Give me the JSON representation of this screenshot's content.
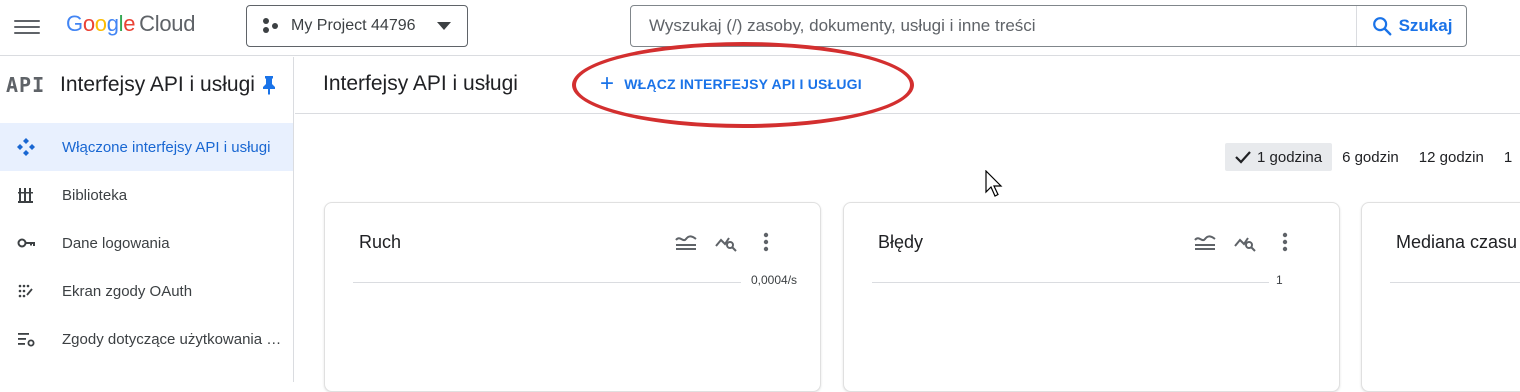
{
  "header": {
    "logo_google": [
      "G",
      "o",
      "o",
      "g",
      "l",
      "e"
    ],
    "logo_cloud": "Cloud",
    "project_name": "My Project 44796",
    "search_placeholder": "Wyszukaj (/) zasoby, dokumenty, usługi i inne treści",
    "search_button": "Szukaj"
  },
  "sidebar": {
    "icon_text": "API",
    "title": "Interfejsy API i usługi",
    "items": [
      {
        "label": "Włączone interfejsy API i usługi",
        "icon": "api-diamond-icon",
        "active": true
      },
      {
        "label": "Biblioteka",
        "icon": "library-icon",
        "active": false
      },
      {
        "label": "Dane logowania",
        "icon": "key-icon",
        "active": false
      },
      {
        "label": "Ekran zgody OAuth",
        "icon": "oauth-consent-icon",
        "active": false
      },
      {
        "label": "Zgody dotyczące użytkowania danych",
        "icon": "data-usage-icon",
        "active": false
      }
    ]
  },
  "main": {
    "title": "Interfejsy API i usługi",
    "enable_button": "WŁĄCZ INTERFEJSY API I USŁUGI",
    "time_range": {
      "options": [
        "1 godzina",
        "6 godzin",
        "12 godzin",
        "1"
      ],
      "selected": "1 godzina"
    },
    "cards": [
      {
        "title": "Ruch",
        "axis_label": "0,0004/s"
      },
      {
        "title": "Błędy",
        "axis_label": "1"
      },
      {
        "title": "Mediana czasu",
        "axis_label": ""
      }
    ]
  },
  "colors": {
    "accent": "#1a73e8",
    "highlight": "#d32f2f",
    "active_bg": "#e8f0fe"
  }
}
